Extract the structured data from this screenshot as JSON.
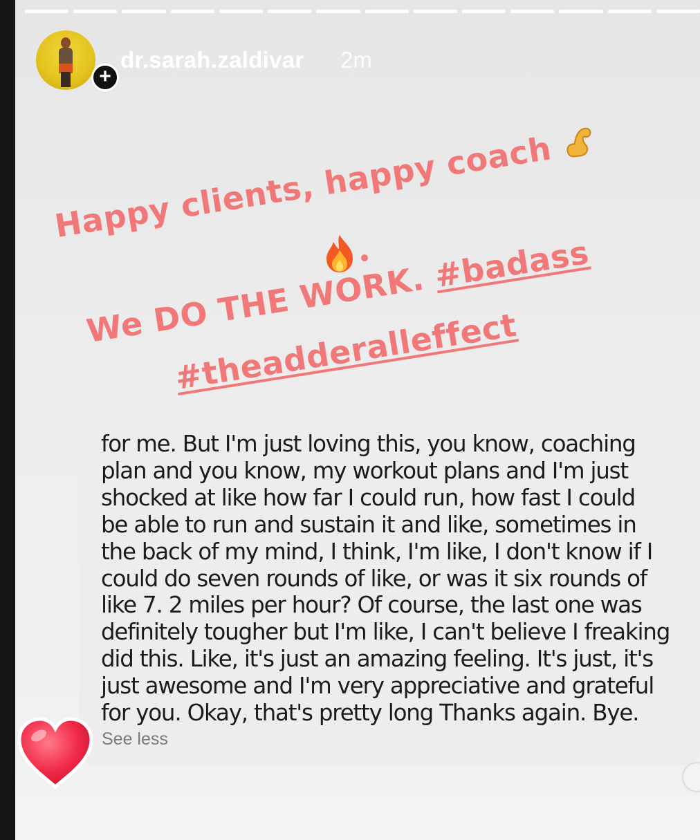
{
  "story": {
    "username": "dr.sarah.zaldivar",
    "time": "2m",
    "add_icon": "plus-icon",
    "progress_segments": 14
  },
  "caption": {
    "line1": "Happy clients, happy coach",
    "line2_prefix": "We DO THE WORK. ",
    "hashtag1": "#badass",
    "hashtag2": "#theadderalleffect",
    "dot": ".",
    "color": "#f07878"
  },
  "message": {
    "lines": [
      "for me. But I'm just loving this, you know, coaching",
      "plan and you know, my workout plans and I'm just",
      "shocked at like how far I could run, how fast I could",
      "be able to run and sustain it and like, sometimes in",
      "the back of my mind, I think, I'm like, I don't know if I",
      "could do seven rounds of like, or was it six rounds of",
      "like 7. 2 miles per hour? Of course, the last one was",
      "definitely tougher but I'm like, I can't believe I freaking",
      "did this. Like, it's just an amazing feeling. It's just, it's",
      "just awesome and I'm very appreciative and grateful",
      "for you. Okay, that's pretty long Thanks again. Bye."
    ],
    "see_less": "See less"
  },
  "icons": {
    "arm": "flexed-biceps-icon",
    "fire": "fire-icon",
    "heart": "heart-reaction-icon"
  }
}
